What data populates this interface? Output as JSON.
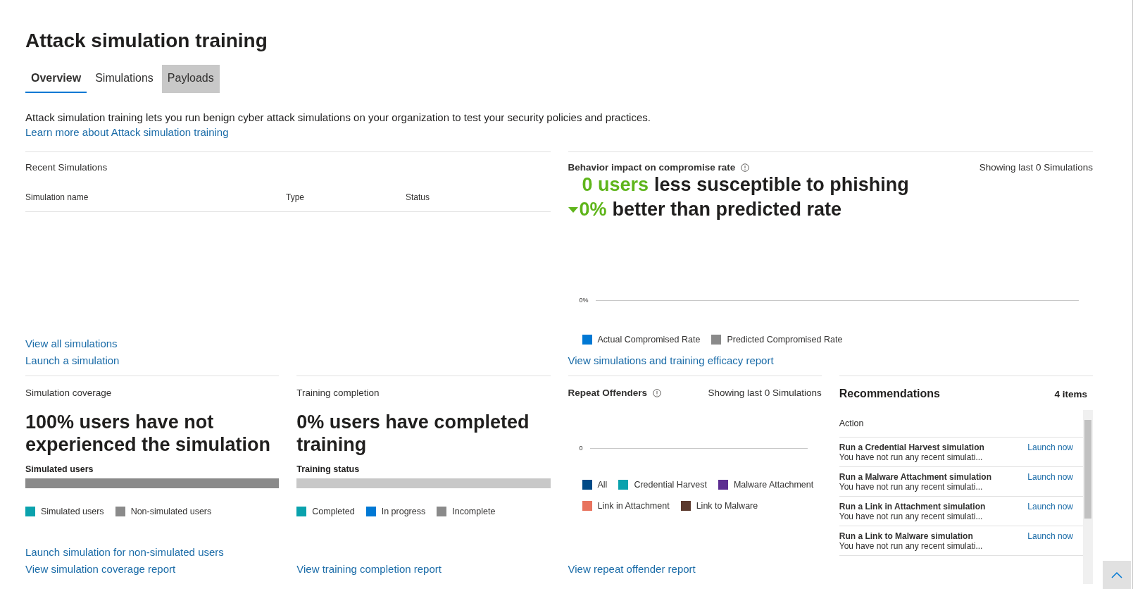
{
  "page": {
    "title": "Attack simulation training"
  },
  "tabs": [
    {
      "label": "Overview",
      "selected": true,
      "hovered": false
    },
    {
      "label": "Simulations",
      "selected": false,
      "hovered": false
    },
    {
      "label": "Payloads",
      "selected": false,
      "hovered": true
    }
  ],
  "description": "Attack simulation training lets you run benign cyber attack simulations on your organization to test your security policies and practices.",
  "learn_more_link": "Learn more about Attack simulation training",
  "recent_simulations": {
    "title": "Recent Simulations",
    "columns": [
      "Simulation name",
      "Type",
      "Status"
    ],
    "links": [
      "View all simulations",
      "Launch a simulation"
    ]
  },
  "behavior_impact": {
    "title": "Behavior impact on compromise rate",
    "showing": "Showing last 0 Simulations",
    "headline_value": "0 users",
    "headline_text": "less susceptible to phishing",
    "rate_value": "0%",
    "rate_text": "better than predicted rate",
    "axis_tick": "0%",
    "legend": [
      {
        "label": "Actual Compromised Rate",
        "color": "#0078d4"
      },
      {
        "label": "Predicted Compromised Rate",
        "color": "#8a8a8a"
      }
    ],
    "link": "View simulations and training efficacy report"
  },
  "simulation_coverage": {
    "title": "Simulation coverage",
    "headline": "100% users have not experienced the simulation",
    "bar_label": "Simulated users",
    "level": 0,
    "legend": [
      {
        "label": "Simulated users",
        "color": "#0aa2ad"
      },
      {
        "label": "Non-simulated users",
        "color": "#8a8a8a"
      }
    ],
    "links": [
      "Launch simulation for non-simulated users",
      "View simulation coverage report"
    ]
  },
  "training_completion": {
    "title": "Training completion",
    "headline": "0% users have completed training",
    "bar_label": "Training status",
    "level": 0,
    "legend": [
      {
        "label": "Completed",
        "color": "#0aa2ad"
      },
      {
        "label": "In progress",
        "color": "#0078d4"
      },
      {
        "label": "Incomplete",
        "color": "#8a8a8a"
      }
    ],
    "links": [
      "View training completion report"
    ]
  },
  "repeat_offenders": {
    "title": "Repeat Offenders",
    "showing": "Showing last 0 Simulations",
    "axis_tick": "0",
    "legend": [
      {
        "label": "All",
        "color": "#004a87"
      },
      {
        "label": "Credential Harvest",
        "color": "#0aa2ad"
      },
      {
        "label": "Malware Attachment",
        "color": "#5c2d91"
      },
      {
        "label": "Link in Attachment",
        "color": "#e8735e"
      },
      {
        "label": "Link to Malware",
        "color": "#5c3a2e"
      }
    ],
    "link": "View repeat offender report"
  },
  "recommendations": {
    "title": "Recommendations",
    "count": "4 items",
    "column": "Action",
    "rows": [
      {
        "title": "Run a Credential Harvest simulation",
        "detail": "You have not run any recent simulati...",
        "action": "Launch now"
      },
      {
        "title": "Run a Malware Attachment simulation",
        "detail": "You have not run any recent simulati...",
        "action": "Launch now"
      },
      {
        "title": "Run a Link in Attachment simulation",
        "detail": "You have not run any recent simulati...",
        "action": "Launch now"
      },
      {
        "title": "Run a Link to Malware simulation",
        "detail": "You have not run any recent simulati...",
        "action": "Launch now"
      }
    ]
  }
}
